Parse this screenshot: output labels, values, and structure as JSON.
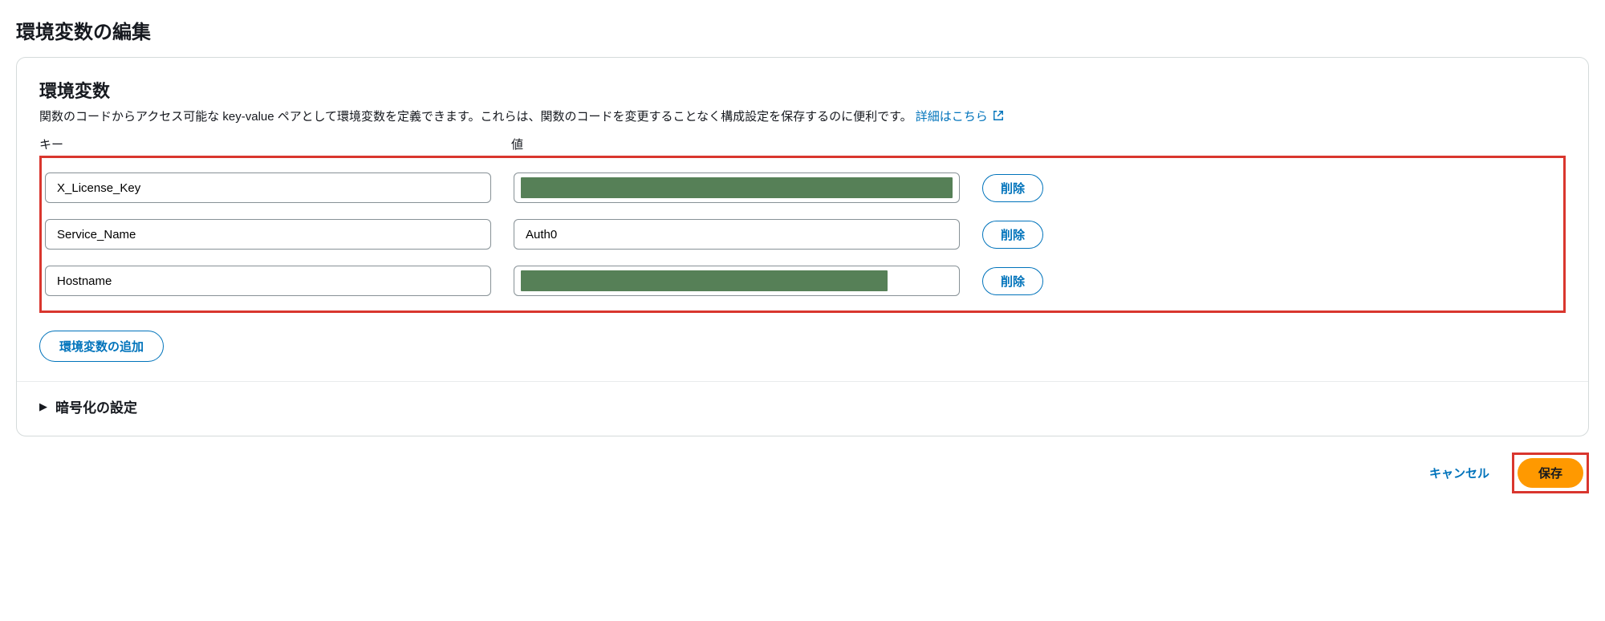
{
  "page": {
    "title": "環境変数の編集"
  },
  "section": {
    "title": "環境変数",
    "desc": "関数のコードからアクセス可能な key-value ペアとして環境変数を定義できます。これらは、関数のコードを変更することなく構成設定を保存するのに便利です。",
    "learn_more": "詳細はこちら"
  },
  "columns": {
    "key": "キー",
    "value": "値"
  },
  "rows": [
    {
      "key": "X_License_Key",
      "value": "",
      "masked": true,
      "mask_width": "full"
    },
    {
      "key": "Service_Name",
      "value": "Auth0",
      "masked": false
    },
    {
      "key": "Hostname",
      "value": "",
      "masked": true,
      "mask_width": "partial"
    }
  ],
  "labels": {
    "remove": "削除",
    "add": "環境変数の追加",
    "encryption": "暗号化の設定",
    "cancel": "キャンセル",
    "save": "保存"
  }
}
